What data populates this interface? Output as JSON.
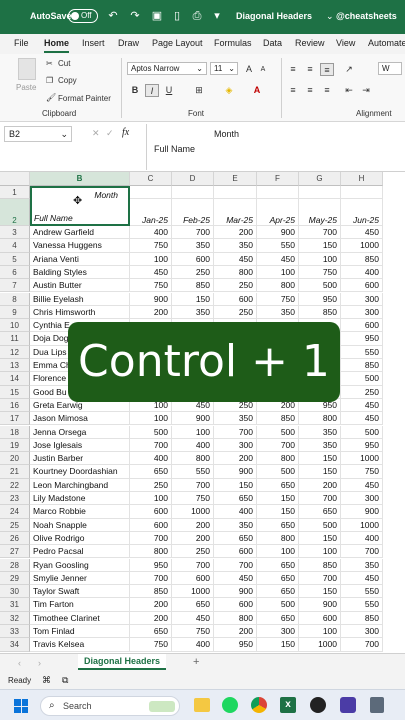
{
  "titlebar": {
    "autosave_label": "AutoSave",
    "autosave_state": "Off",
    "doc_title": "Diagonal Headers",
    "handle": "@cheatsheets"
  },
  "menu": [
    "File",
    "Home",
    "Insert",
    "Draw",
    "Page Layout",
    "Formulas",
    "Data",
    "Review",
    "View",
    "Automate"
  ],
  "ribbon": {
    "paste": "Paste",
    "cut": "Cut",
    "copy": "Copy",
    "format_painter": "Format Painter",
    "clipboard": "Clipboard",
    "font_name": "Aptos Narrow",
    "font_size": "11",
    "bold": "B",
    "italic": "I",
    "underline": "U",
    "font_group": "Font",
    "alignment_group": "Alignment",
    "wrap": "W"
  },
  "formula_bar": {
    "cell_ref": "B2",
    "fx": "fx",
    "line1": "Month",
    "line2": "Full Name"
  },
  "columns": [
    "B",
    "C",
    "D",
    "E",
    "F",
    "G",
    "H"
  ],
  "header_cell": {
    "top": "Month",
    "bottom": "Full Name"
  },
  "months": [
    "Jan-25",
    "Feb-25",
    "Mar-25",
    "Apr-25",
    "May-25",
    "Jun-25"
  ],
  "rows": [
    {
      "n": "3",
      "name": "Andrew Garfield",
      "v": [
        "400",
        "700",
        "200",
        "900",
        "700",
        "450"
      ]
    },
    {
      "n": "4",
      "name": "Vanessa Huggens",
      "v": [
        "750",
        "350",
        "350",
        "550",
        "150",
        "1000"
      ]
    },
    {
      "n": "5",
      "name": "Ariana Venti",
      "v": [
        "100",
        "600",
        "450",
        "450",
        "100",
        "850"
      ]
    },
    {
      "n": "6",
      "name": "Balding Styles",
      "v": [
        "450",
        "250",
        "800",
        "100",
        "750",
        "400"
      ]
    },
    {
      "n": "7",
      "name": "Austin Butter",
      "v": [
        "750",
        "850",
        "250",
        "800",
        "500",
        "600"
      ]
    },
    {
      "n": "8",
      "name": "Billie Eyelash",
      "v": [
        "900",
        "150",
        "600",
        "750",
        "950",
        "300"
      ]
    },
    {
      "n": "9",
      "name": "Chris Himsworth",
      "v": [
        "200",
        "350",
        "250",
        "350",
        "850",
        "300"
      ]
    },
    {
      "n": "10",
      "name": "Cynthia E",
      "v": [
        "",
        "",
        "",
        "",
        "",
        "600"
      ]
    },
    {
      "n": "11",
      "name": "Doja Dog",
      "v": [
        "",
        "",
        "",
        "",
        "",
        "950"
      ]
    },
    {
      "n": "12",
      "name": "Dua Lips",
      "v": [
        "",
        "",
        "",
        "",
        "",
        "550"
      ]
    },
    {
      "n": "13",
      "name": "Emma Ch",
      "v": [
        "",
        "",
        "",
        "",
        "",
        "850"
      ]
    },
    {
      "n": "14",
      "name": "Florence",
      "v": [
        "",
        "",
        "",
        "",
        "",
        "500"
      ]
    },
    {
      "n": "15",
      "name": "Good Bu",
      "v": [
        "",
        "",
        "",
        "",
        "",
        "250"
      ]
    },
    {
      "n": "16",
      "name": "Greta Earwig",
      "v": [
        "100",
        "450",
        "250",
        "200",
        "950",
        "450"
      ]
    },
    {
      "n": "17",
      "name": "Jason Mimosa",
      "v": [
        "100",
        "900",
        "350",
        "850",
        "800",
        "450"
      ]
    },
    {
      "n": "18",
      "name": "Jenna Orsega",
      "v": [
        "500",
        "100",
        "700",
        "500",
        "350",
        "500"
      ]
    },
    {
      "n": "19",
      "name": "Jose Iglesais",
      "v": [
        "700",
        "400",
        "300",
        "700",
        "350",
        "950"
      ]
    },
    {
      "n": "20",
      "name": "Justin Barber",
      "v": [
        "400",
        "800",
        "200",
        "800",
        "150",
        "1000"
      ]
    },
    {
      "n": "21",
      "name": "Kourtney Doordashian",
      "v": [
        "650",
        "550",
        "900",
        "500",
        "150",
        "750"
      ]
    },
    {
      "n": "22",
      "name": "Leon Marchingband",
      "v": [
        "250",
        "700",
        "150",
        "650",
        "200",
        "450"
      ]
    },
    {
      "n": "23",
      "name": "Lily Madstone",
      "v": [
        "100",
        "750",
        "650",
        "150",
        "700",
        "300"
      ]
    },
    {
      "n": "24",
      "name": "Marco Robbie",
      "v": [
        "600",
        "1000",
        "400",
        "150",
        "650",
        "900"
      ]
    },
    {
      "n": "25",
      "name": "Noah Snapple",
      "v": [
        "600",
        "200",
        "350",
        "650",
        "500",
        "1000"
      ]
    },
    {
      "n": "26",
      "name": "Olive Rodrigo",
      "v": [
        "700",
        "200",
        "650",
        "800",
        "150",
        "400"
      ]
    },
    {
      "n": "27",
      "name": "Pedro Pacsal",
      "v": [
        "800",
        "250",
        "600",
        "100",
        "100",
        "700"
      ]
    },
    {
      "n": "28",
      "name": "Ryan Goosling",
      "v": [
        "950",
        "700",
        "700",
        "650",
        "850",
        "350"
      ]
    },
    {
      "n": "29",
      "name": "Smylie Jenner",
      "v": [
        "700",
        "600",
        "450",
        "650",
        "700",
        "450"
      ]
    },
    {
      "n": "30",
      "name": "Taylor Swaft",
      "v": [
        "850",
        "1000",
        "900",
        "650",
        "150",
        "550"
      ]
    },
    {
      "n": "31",
      "name": "Tim Farton",
      "v": [
        "200",
        "650",
        "600",
        "500",
        "900",
        "550"
      ]
    },
    {
      "n": "32",
      "name": "Timothee Clarinet",
      "v": [
        "200",
        "450",
        "800",
        "650",
        "600",
        "850"
      ]
    },
    {
      "n": "33",
      "name": "Tom Finlad",
      "v": [
        "650",
        "750",
        "200",
        "300",
        "100",
        "300"
      ]
    },
    {
      "n": "34",
      "name": "Travis Kelsea",
      "v": [
        "750",
        "400",
        "950",
        "150",
        "1000",
        "700"
      ]
    }
  ],
  "overlay_text": "Control + 1",
  "sheet_tab": "Diagonal Headers",
  "status": "Ready",
  "taskbar": {
    "search": "Search"
  }
}
